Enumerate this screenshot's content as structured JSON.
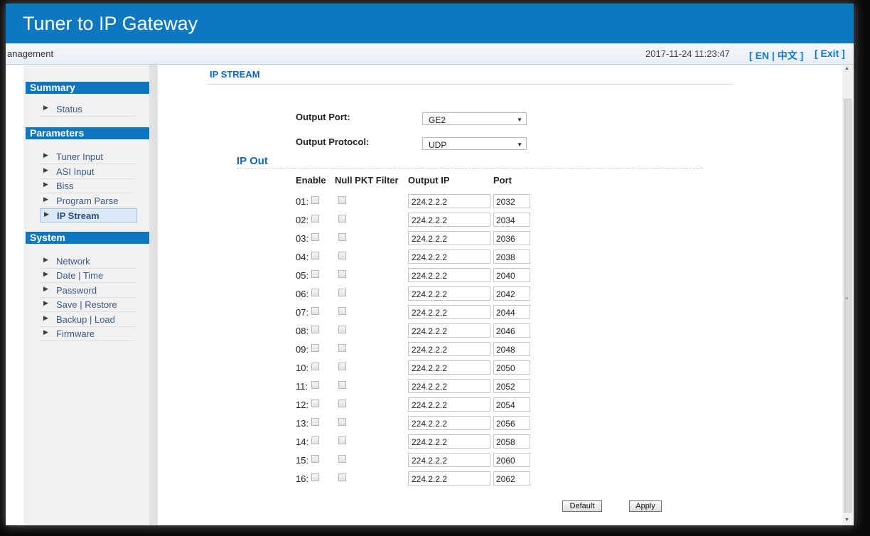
{
  "header": {
    "title": "Tuner to IP Gateway"
  },
  "subbar": {
    "management": "anagement",
    "datetime": "2017-11-24 11:23:47",
    "lang_open": "[ ",
    "lang_en": "EN",
    "lang_sep": " | ",
    "lang_zh": "中文",
    "lang_close": " ]",
    "exit": "[ Exit ]"
  },
  "sidebar": {
    "sections": [
      {
        "title": "Summary",
        "items": [
          "Status"
        ]
      },
      {
        "title": "Parameters",
        "items": [
          "Tuner Input",
          "ASI Input",
          "Biss",
          "Program Parse",
          "IP Stream"
        ]
      },
      {
        "title": "System",
        "items": [
          "Network",
          "Date | Time",
          "Password",
          "Save | Restore",
          "Backup | Load",
          "Firmware"
        ]
      }
    ],
    "active": "IP Stream"
  },
  "main": {
    "title": "IP STREAM",
    "output_port_label": "Output Port:",
    "output_port_value": "GE2",
    "output_protocol_label": "Output Protocol:",
    "output_protocol_value": "UDP",
    "ipout_title": "IP Out",
    "columns": {
      "enable": "Enable",
      "null_pkt": "Null PKT Filter",
      "output_ip": "Output IP",
      "port": "Port"
    },
    "rows": [
      {
        "num": "01:",
        "ip": "224.2.2.2",
        "port": "2032"
      },
      {
        "num": "02:",
        "ip": "224.2.2.2",
        "port": "2034"
      },
      {
        "num": "03:",
        "ip": "224.2.2.2",
        "port": "2036"
      },
      {
        "num": "04:",
        "ip": "224.2.2.2",
        "port": "2038"
      },
      {
        "num": "05:",
        "ip": "224.2.2.2",
        "port": "2040"
      },
      {
        "num": "06:",
        "ip": "224.2.2.2",
        "port": "2042"
      },
      {
        "num": "07:",
        "ip": "224.2.2.2",
        "port": "2044"
      },
      {
        "num": "08:",
        "ip": "224.2.2.2",
        "port": "2046"
      },
      {
        "num": "09:",
        "ip": "224.2.2.2",
        "port": "2048"
      },
      {
        "num": "10:",
        "ip": "224.2.2.2",
        "port": "2050"
      },
      {
        "num": "11:",
        "ip": "224.2.2.2",
        "port": "2052"
      },
      {
        "num": "12:",
        "ip": "224.2.2.2",
        "port": "2054"
      },
      {
        "num": "13:",
        "ip": "224.2.2.2",
        "port": "2056"
      },
      {
        "num": "14:",
        "ip": "224.2.2.2",
        "port": "2058"
      },
      {
        "num": "15:",
        "ip": "224.2.2.2",
        "port": "2060"
      },
      {
        "num": "16:",
        "ip": "224.2.2.2",
        "port": "2062"
      }
    ],
    "default_button": "Default",
    "apply_button": "Apply"
  },
  "colors": {
    "brand": "#0d78bf",
    "link": "#0a78d6",
    "heading": "#1066b8"
  }
}
